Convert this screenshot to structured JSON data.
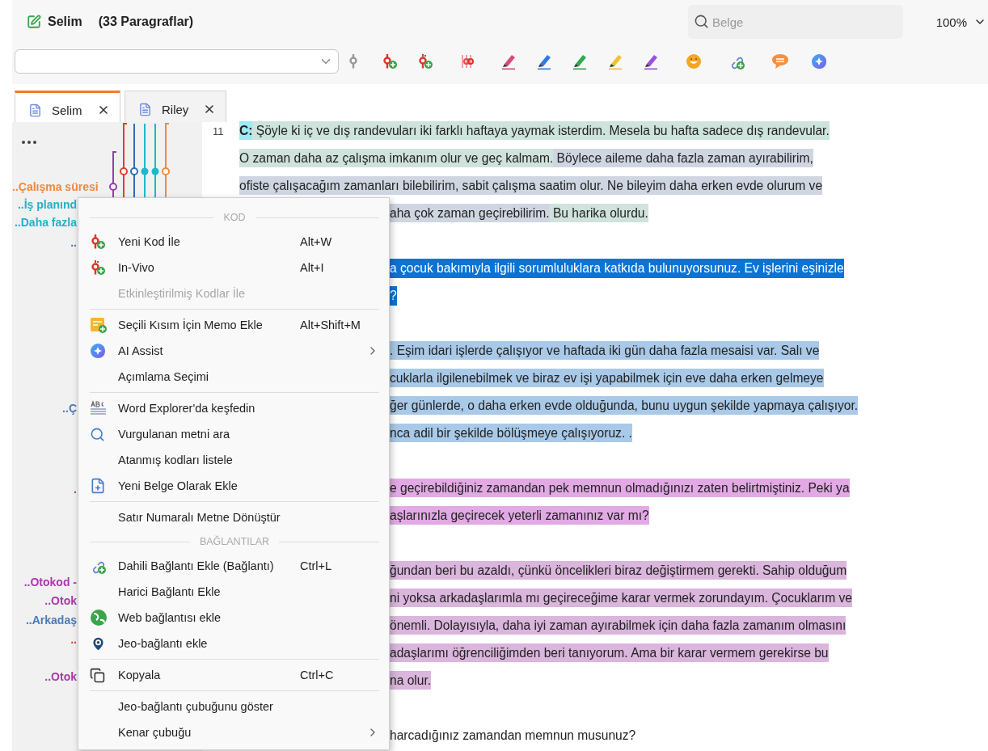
{
  "document": {
    "title": "Selim",
    "paragraph_count": "(33 Paragraflar)"
  },
  "search": {
    "placeholder": "Belge"
  },
  "zoom": "100%",
  "tabs": [
    {
      "label": "Selim",
      "selected": true
    },
    {
      "label": "Riley",
      "selected": false
    }
  ],
  "margin_labels": [
    {
      "text": "..Çalışma süresi",
      "color": "#f0883c"
    },
    {
      "text": "..İş planınd",
      "color": "#22b2c8"
    },
    {
      "text": "..Daha fazla",
      "color": "#22b2c8"
    },
    {
      "text": "..",
      "color": "#4a7ab8"
    },
    {
      "text": "..Ç",
      "color": "#4a7ab8"
    },
    {
      "text": ".",
      "color": "#b040b0"
    },
    {
      "text": "..Otokod -",
      "color": "#b035b0"
    },
    {
      "text": "..Otok",
      "color": "#a83aa8"
    },
    {
      "text": "..Arkadaş",
      "color": "#4a7ab8"
    },
    {
      "text": "..",
      "color": "#e04030"
    },
    {
      "text": "..Otok",
      "color": "#a83aa8"
    }
  ],
  "line_number": "11",
  "lines": [
    {
      "kind": "full",
      "selected": false,
      "segments": [
        {
          "text": "C:",
          "bold": true,
          "color": "#9eeaf2"
        },
        {
          "text": " Şöyle ki iç ve dış randevuları iki farklı haftaya yaymak isterdim. Mesela bu hafta sadece dış randevular.",
          "bold": false,
          "color": "#cde4dd"
        }
      ]
    },
    {
      "kind": "full",
      "selected": false,
      "segments": [
        {
          "text": "O zaman daha az çalışma imkanım olur ve geç kalmam.",
          "bold": false,
          "color": "#cfe3dc"
        },
        {
          "text": " Böylece aileme daha fazla zaman ayırabilirim,",
          "bold": false,
          "color": "#cfd6e2"
        }
      ]
    },
    {
      "kind": "full",
      "selected": false,
      "segments": [
        {
          "text": "ofiste çalışacağım zamanları bilebilirim, sabit çalışma saatim olur. Ne bileyim daha erken evde olurum ve",
          "bold": false,
          "color": "#cfd6e2"
        }
      ]
    },
    {
      "kind": "partial",
      "selected": false,
      "segments": [
        {
          "text": "aha çok zaman geçirebilirim.",
          "bold": false,
          "color": "#cfd6e2"
        },
        {
          "text": " Bu harika olurdu.",
          "bold": false,
          "color": "#cfe3dc"
        }
      ]
    },
    {
      "kind": "blank"
    },
    {
      "kind": "partial",
      "selected": true,
      "segments": [
        {
          "text": "a çocuk bakımıyla ilgili sorumluluklara katkıda bulunuyorsunuz. Ev işlerini eşinizle",
          "bold": false
        }
      ]
    },
    {
      "kind": "partial",
      "selected": true,
      "segments": [
        {
          "text": "?",
          "bold": false
        }
      ]
    },
    {
      "kind": "blank"
    },
    {
      "kind": "partial",
      "selected": false,
      "segments": [
        {
          "text": ". Eşim idari işlerde çalışıyor ve haftada iki gün daha fazla mesaisi var. Salı ve",
          "bold": false,
          "color": "#a9c9e8"
        }
      ]
    },
    {
      "kind": "partial",
      "selected": false,
      "segments": [
        {
          "text": "cuklarla ilgilenebilmek ve biraz ev işi yapabilmek için eve daha erken gelmeye",
          "bold": false,
          "color": "#a9c9e8"
        }
      ]
    },
    {
      "kind": "partial",
      "selected": false,
      "segments": [
        {
          "text": "ğer günlerde, o daha erken evde olduğunda, bunu uygun şekilde yapmaya çalışıyor.",
          "bold": false,
          "color": "#a9c9e8"
        }
      ]
    },
    {
      "kind": "partial",
      "selected": false,
      "segments": [
        {
          "text": "nca adil bir şekilde bölüşmeye çalışıyoruz. .",
          "bold": false,
          "color": "#a9c9e8"
        }
      ]
    },
    {
      "kind": "blank"
    },
    {
      "kind": "partial",
      "selected": false,
      "segments": [
        {
          "text": "e geçirebildiğiniz zamandan pek memnun olmadığınızı zaten belirtmiştiniz. Peki ya",
          "bold": false,
          "color": "#e2a9e4"
        }
      ]
    },
    {
      "kind": "partial",
      "selected": false,
      "segments": [
        {
          "text": "aşlarınızla geçirecek yeterli zamanınız var mı?",
          "bold": false,
          "color": "#e2a9e4"
        }
      ]
    },
    {
      "kind": "blank"
    },
    {
      "kind": "partial",
      "selected": false,
      "segments": [
        {
          "text": "ğundan beri bu azaldı, çünkü öncelikleri biraz değiştirmem gerekti. Sahip olduğum",
          "bold": false,
          "color": "#dab5dc"
        }
      ]
    },
    {
      "kind": "partial",
      "selected": false,
      "segments": [
        {
          "text": "ni yoksa arkadaşlarımla mı geçireceğime karar vermek zorundayım. Çocuklarım ve",
          "bold": false,
          "color": "#dab5dc"
        }
      ]
    },
    {
      "kind": "partial",
      "selected": false,
      "segments": [
        {
          "text": "önemli. Dolayısıyla, daha iyi zaman ayırabilmek için daha fazla zamanım olmasını",
          "bold": false,
          "color": "#dab5dc"
        }
      ]
    },
    {
      "kind": "partial",
      "selected": false,
      "segments": [
        {
          "text": "adaşlarımı öğrenciliğimden beri tanıyorum. Ama bir karar vermem gerekirse bu",
          "bold": false,
          "color": "#dab5dc"
        }
      ]
    },
    {
      "kind": "partial",
      "selected": false,
      "segments": [
        {
          "text": "na olur.",
          "bold": false,
          "color": "#dab5dc"
        }
      ]
    },
    {
      "kind": "blank"
    },
    {
      "kind": "partial",
      "selected": false,
      "segments": [
        {
          "text": "harcadığınız zamandan memnun musunuz?",
          "bold": false
        }
      ]
    }
  ],
  "context_menu": {
    "items": [
      {
        "kind": "header",
        "label": "KOD"
      },
      {
        "kind": "item",
        "label": "Yeni Kod İle",
        "shortcut": "Alt+W",
        "disabled": false,
        "submenu": false
      },
      {
        "kind": "item",
        "label": "In-Vivo",
        "shortcut": "Alt+I",
        "disabled": false,
        "submenu": false
      },
      {
        "kind": "item",
        "label": "Etkinleştirilmiş Kodlar İle",
        "disabled": true,
        "submenu": false
      },
      {
        "kind": "separator"
      },
      {
        "kind": "item",
        "label": "Seçili Kısım İçin Memo Ekle",
        "shortcut": "Alt+Shift+M",
        "disabled": false,
        "submenu": false
      },
      {
        "kind": "item",
        "label": "AI Assist",
        "disabled": false,
        "submenu": true
      },
      {
        "kind": "item",
        "label": "Açımlama Seçimi",
        "disabled": false,
        "submenu": false
      },
      {
        "kind": "separator"
      },
      {
        "kind": "item",
        "label": "Word Explorer'da keşfedin",
        "disabled": false,
        "submenu": false
      },
      {
        "kind": "item",
        "label": "Vurgulanan metni ara",
        "disabled": false,
        "submenu": false
      },
      {
        "kind": "item",
        "label": "Atanmış kodları listele",
        "disabled": false,
        "submenu": false
      },
      {
        "kind": "item",
        "label": "Yeni Belge Olarak Ekle",
        "disabled": false,
        "submenu": false
      },
      {
        "kind": "separator"
      },
      {
        "kind": "item",
        "label": "Satır Numaralı Metne Dönüştür",
        "disabled": false,
        "submenu": false
      },
      {
        "kind": "header",
        "label": "BAĞLANTILAR"
      },
      {
        "kind": "item",
        "label": "Dahili Bağlantı Ekle (Bağlantı)",
        "shortcut": "Ctrl+L",
        "disabled": false,
        "submenu": false
      },
      {
        "kind": "item",
        "label": "Harici Bağlantı Ekle",
        "disabled": false,
        "submenu": false
      },
      {
        "kind": "item",
        "label": "Web bağlantısı ekle",
        "disabled": false,
        "submenu": false
      },
      {
        "kind": "item",
        "label": "Jeo-bağlantı ekle",
        "disabled": false,
        "submenu": false
      },
      {
        "kind": "separator"
      },
      {
        "kind": "item",
        "label": "Kopyala",
        "shortcut": "Ctrl+C",
        "disabled": false,
        "submenu": false
      },
      {
        "kind": "separator"
      },
      {
        "kind": "item",
        "label": "Jeo-bağlantı çubuğunu göster",
        "disabled": false,
        "submenu": false
      },
      {
        "kind": "item",
        "label": "Kenar çubuğu",
        "disabled": false,
        "submenu": true
      }
    ]
  }
}
